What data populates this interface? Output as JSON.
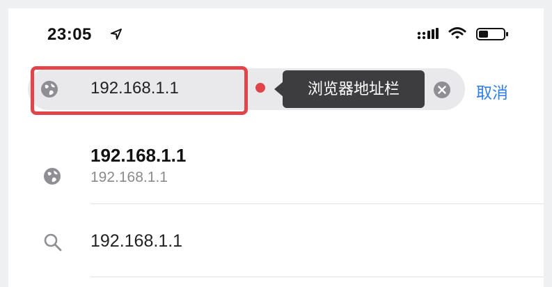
{
  "status_bar": {
    "time": "23:05"
  },
  "address_bar": {
    "url": "192.168.1.1",
    "tooltip": "浏览器地址栏",
    "cancel_label": "取消"
  },
  "suggestions": [
    {
      "title": "192.168.1.1",
      "subtitle": "192.168.1.1",
      "icon": "globe-icon"
    },
    {
      "title": "192.168.1.1",
      "icon": "search-icon"
    }
  ],
  "colors": {
    "accent": "#2f7ee6",
    "highlight": "#e0454a",
    "tooltip_bg": "#3d3d3f",
    "address_bar_bg": "#e9e9ec"
  }
}
